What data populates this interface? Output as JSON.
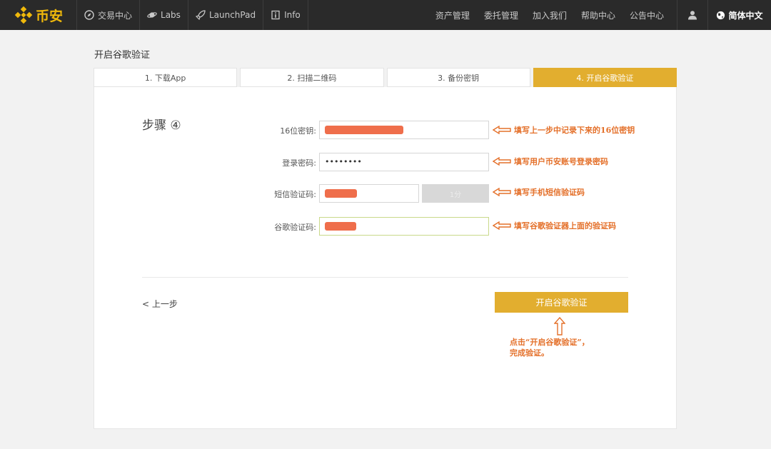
{
  "brand": {
    "name": "币安",
    "accent": "#f0b90b"
  },
  "nav": {
    "left": [
      {
        "label": "交易中心",
        "icon": "compass-icon"
      },
      {
        "label": "Labs",
        "icon": "planet-icon"
      },
      {
        "label": "LaunchPad",
        "icon": "rocket-icon"
      },
      {
        "label": "Info",
        "icon": "info-icon"
      }
    ],
    "right": [
      "资产管理",
      "委托管理",
      "加入我们",
      "帮助中心",
      "公告中心"
    ],
    "user_icon": "user-icon",
    "language": "简体中文"
  },
  "page_title": "开启谷歌验证",
  "steps": [
    {
      "label": "1. 下载App",
      "active": false
    },
    {
      "label": "2. 扫描二维码",
      "active": false
    },
    {
      "label": "3. 备份密钥",
      "active": false
    },
    {
      "label": "4. 开启谷歌验证",
      "active": true
    }
  ],
  "step_heading": "步骤 ④",
  "form": {
    "secret_key_label": "16位密钥:",
    "login_password_label": "登录密码:",
    "login_password_value": "••••••••",
    "sms_code_label": "短信验证码:",
    "sms_button_label": "1分",
    "google_code_label": "谷歌验证码:"
  },
  "annotations": {
    "secret_key": "填写上一步中记录下来的16位密钥",
    "login_password": "填写用户币安账号登录密码",
    "sms_code": "填写手机短信验证码",
    "google_code": "填写谷歌验证器上面的验证码",
    "click_note_line1": "点击“开启谷歌验证”，",
    "click_note_line2": "完成验证。"
  },
  "actions": {
    "prev_label": "< 上一步",
    "submit_label": "开启谷歌验证"
  },
  "colors": {
    "topbar": "#2a2a2a",
    "active_step": "#e2ae2f",
    "annotation": "#e4702a",
    "redaction": "#ef6e4b"
  }
}
